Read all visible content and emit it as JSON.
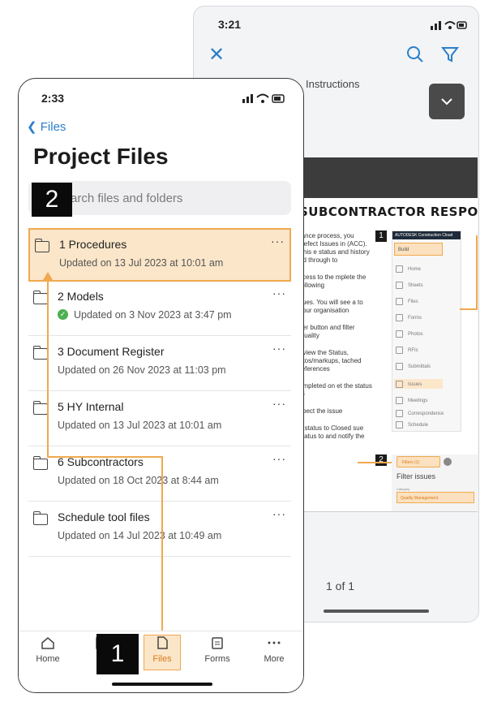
{
  "back_screen": {
    "status_time": "3:21",
    "doc_title": "Instructions",
    "doc_heading": "SUBCONTRACTOR RESPONSE",
    "doc_paragraphs": [
      "rance process, you Defect Issues in (ACC). This e status and history ed through to",
      "ccess to the mplete the following",
      "sues. You will see a to your organisation",
      "lter button and filter Quality",
      "eview the Status, otos/markups, tached references",
      "ompleted on et the status to",
      "spect the issue",
      "e status to Closed sue status to and notify the"
    ],
    "step_labels": [
      "1",
      "2"
    ],
    "acc_brand": "AUTODESK Construction Cloud",
    "acc_build": "Build",
    "acc_items": [
      "Home",
      "Sheets",
      "Files",
      "Issues",
      "Forms",
      "Photos",
      "RFIs",
      "Submittals",
      "Meetings",
      "Correspondence",
      "Schedule"
    ],
    "filter_pill": "Filters (1)",
    "filter_title": "Filter issues",
    "filter_category_label": "Category",
    "filter_category_value": "Quality Management",
    "page_indicator": "1 of 1"
  },
  "front_screen": {
    "status_time": "2:33",
    "back_link": "Files",
    "page_title": "Project Files",
    "search_placeholder": "arch files and folders",
    "search_callout": "2",
    "files": [
      {
        "name": "1 Procedures",
        "updated": "Updated on 13 Jul 2023 at 10:01 am",
        "highlighted": true,
        "synced": false
      },
      {
        "name": "2 Models",
        "updated": "Updated on 3 Nov 2023 at 3:47 pm",
        "highlighted": false,
        "synced": true
      },
      {
        "name": "3 Document Register",
        "updated": "Updated on 26 Nov 2023 at 11:03 pm",
        "highlighted": false,
        "synced": false
      },
      {
        "name": "5 HY Internal",
        "updated": "Updated on 13 Jul 2023 at 10:01 am",
        "highlighted": false,
        "synced": false
      },
      {
        "name": "6 Subcontractors",
        "updated": "Updated on 18 Oct 2023 at 8:44 am",
        "highlighted": false,
        "synced": false
      },
      {
        "name": "Schedule tool files",
        "updated": "Updated on 14 Jul 2023 at 10:49 am",
        "highlighted": false,
        "synced": false
      }
    ],
    "more_label": "···",
    "tabs": [
      {
        "label": "Home",
        "icon": "home-icon"
      },
      {
        "label": "S",
        "icon": "sheets-icon"
      },
      {
        "label": "Files",
        "icon": "file-icon"
      },
      {
        "label": "Forms",
        "icon": "clipboard-icon"
      },
      {
        "label": "More",
        "icon": "more-icon"
      }
    ],
    "tab_callout": "1",
    "accent_color": "#f0a94f",
    "link_color": "#2a7fc9"
  }
}
